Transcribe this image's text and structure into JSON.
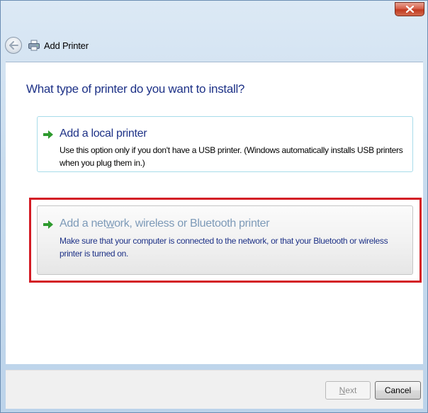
{
  "window": {
    "title": "Add Printer",
    "close_symbol": "x",
    "icons": {
      "back": "back-arrow-icon",
      "app": "printer-icon",
      "close": "close-icon"
    }
  },
  "main": {
    "heading": "What type of printer do you want to install?",
    "options": [
      {
        "icon": "green-arrow-icon",
        "title": "Add a local printer",
        "description": "Use this option only if you don't have a USB printer. (Windows automatically installs USB printers when you plug them in.)"
      },
      {
        "icon": "green-arrow-icon",
        "title_before": "Add a net",
        "title_underlined": "w",
        "title_after": "ork, wireless or Bluetooth printer",
        "description": "Make sure that your computer is connected to the network, or that your Bluetooth or wireless printer is turned on.",
        "highlighted": true
      }
    ]
  },
  "footer": {
    "next": {
      "before": "",
      "underlined": "N",
      "after": "ext",
      "enabled": false
    },
    "cancel": "Cancel"
  },
  "colors": {
    "heading": "#1e3287",
    "highlight_border": "#d31c25",
    "arrow": "#2e9a2e",
    "hover_title": "#7d9ab8"
  }
}
